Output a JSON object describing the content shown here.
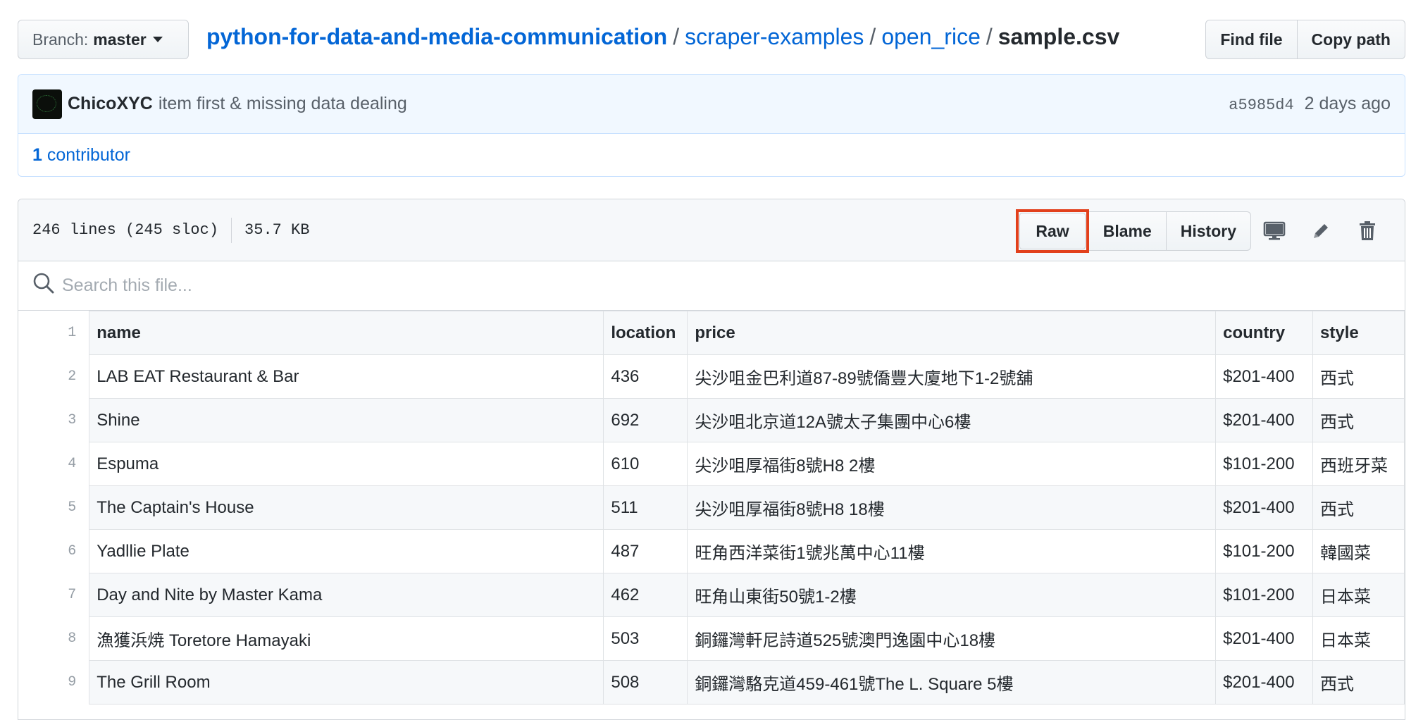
{
  "branch": {
    "prefix": "Branch:",
    "name": "master"
  },
  "breadcrumb": {
    "repo": "python-for-data-and-media-communication",
    "dir1": "scraper-examples",
    "dir2": "open_rice",
    "file": "sample.csv",
    "separator": "/"
  },
  "path_buttons": {
    "find_file": "Find file",
    "copy_path": "Copy path"
  },
  "commit": {
    "author": "ChicoXYC",
    "message": "item first & missing data dealing",
    "sha": "a5985d4",
    "time": "2 days ago"
  },
  "contributors": {
    "count": "1",
    "label": "contributor"
  },
  "file_info": {
    "lines": "246 lines (245 sloc)",
    "size": "35.7 KB"
  },
  "file_actions": {
    "raw": "Raw",
    "blame": "Blame",
    "history": "History"
  },
  "search": {
    "placeholder": "Search this file..."
  },
  "table": {
    "header_line": "1",
    "headers": [
      "name",
      "location",
      "price",
      "country",
      "style"
    ],
    "rows": [
      {
        "line": "2",
        "cells": [
          "LAB EAT Restaurant & Bar",
          "436",
          "尖沙咀金巴利道87-89號僑豐大廈地下1-2號舖",
          "$201-400",
          "西式"
        ]
      },
      {
        "line": "3",
        "cells": [
          "Shine",
          "692",
          "尖沙咀北京道12A號太子集團中心6樓",
          "$201-400",
          "西式"
        ]
      },
      {
        "line": "4",
        "cells": [
          "Espuma",
          "610",
          "尖沙咀厚福街8號H8 2樓",
          "$101-200",
          "西班牙菜"
        ]
      },
      {
        "line": "5",
        "cells": [
          "The Captain's House",
          "511",
          "尖沙咀厚福街8號H8 18樓",
          "$201-400",
          "西式"
        ]
      },
      {
        "line": "6",
        "cells": [
          "Yadllie Plate",
          "487",
          "旺角西洋菜街1號兆萬中心11樓",
          "$101-200",
          "韓國菜"
        ]
      },
      {
        "line": "7",
        "cells": [
          "Day and Nite by Master Kama",
          "462",
          "旺角山東街50號1-2樓",
          "$101-200",
          "日本菜"
        ]
      },
      {
        "line": "8",
        "cells": [
          "漁獲浜焼 Toretore Hamayaki",
          "503",
          "銅鑼灣軒尼詩道525號澳門逸園中心18樓",
          "$201-400",
          "日本菜"
        ]
      },
      {
        "line": "9",
        "cells": [
          "The Grill Room",
          "508",
          "銅鑼灣駱克道459-461號The L. Square 5樓",
          "$201-400",
          "西式"
        ]
      }
    ]
  },
  "colors": {
    "link": "#0366d6",
    "highlight": "#e2401c",
    "commit_bg": "#f1f8ff"
  },
  "icons": [
    "desktop-icon",
    "pencil-icon",
    "trash-icon",
    "search-icon",
    "caret-down-icon"
  ]
}
